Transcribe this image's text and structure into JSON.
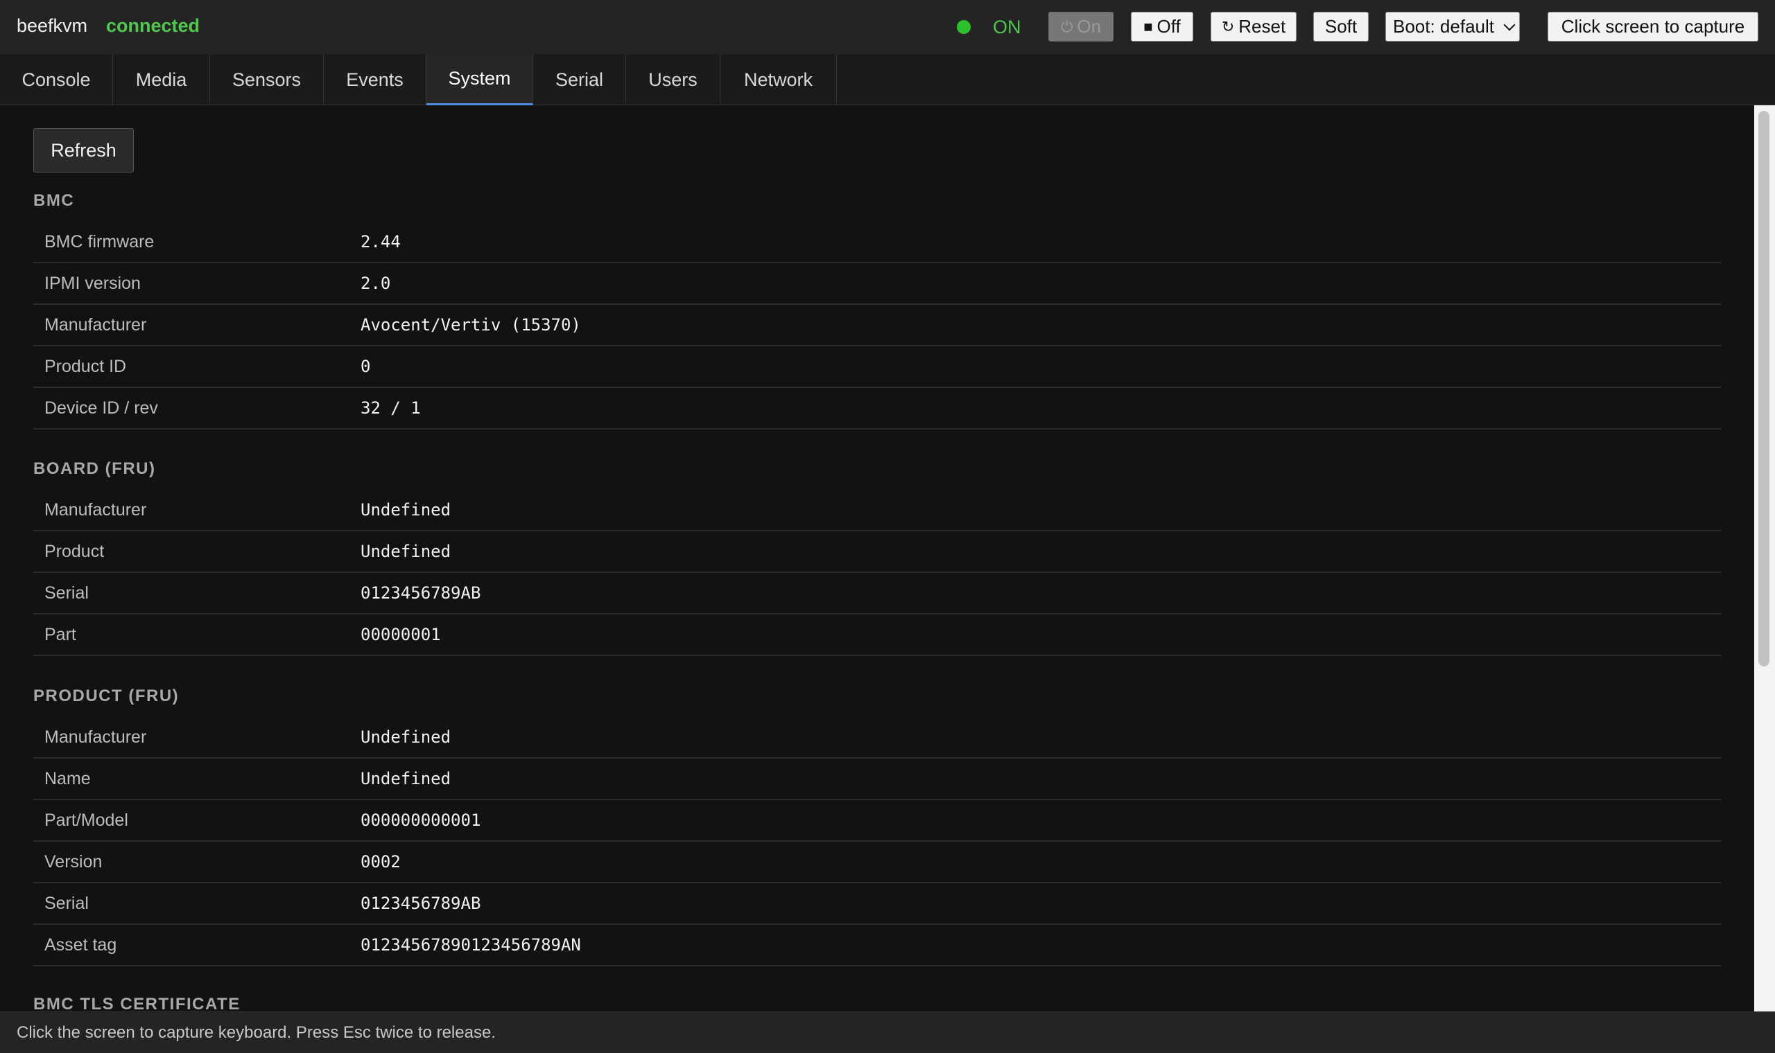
{
  "header": {
    "hostname": "beefkvm",
    "connection_status": "connected",
    "power_state": "ON",
    "buttons": {
      "on": "On",
      "off": "Off",
      "reset": "Reset",
      "soft": "Soft",
      "boot": "Boot: default",
      "capture": "Click screen to capture"
    },
    "icons": {
      "on": "power-icon",
      "off": "stop-square-icon",
      "reset": "reload-icon"
    },
    "colors": {
      "connected": "#4ec94e",
      "power_dot": "#2bc12b",
      "tab_active_accent": "#4a90e2"
    }
  },
  "tabs": [
    "Console",
    "Media",
    "Sensors",
    "Events",
    "System",
    "Serial",
    "Users",
    "Network"
  ],
  "active_tab": "System",
  "refresh_label": "Refresh",
  "sections": {
    "bmc": {
      "title": "BMC",
      "rows": [
        {
          "k": "BMC firmware",
          "v": "2.44"
        },
        {
          "k": "IPMI version",
          "v": "2.0"
        },
        {
          "k": "Manufacturer",
          "v": "Avocent/Vertiv (15370)"
        },
        {
          "k": "Product ID",
          "v": "0"
        },
        {
          "k": "Device ID / rev",
          "v": "32 / 1"
        }
      ]
    },
    "board": {
      "title": "BOARD (FRU)",
      "rows": [
        {
          "k": "Manufacturer",
          "v": "Undefined"
        },
        {
          "k": "Product",
          "v": "Undefined"
        },
        {
          "k": "Serial",
          "v": "0123456789AB"
        },
        {
          "k": "Part",
          "v": "00000001"
        }
      ]
    },
    "product": {
      "title": "PRODUCT (FRU)",
      "rows": [
        {
          "k": "Manufacturer",
          "v": "Undefined"
        },
        {
          "k": "Name",
          "v": "Undefined"
        },
        {
          "k": "Part/Model",
          "v": "000000000001"
        },
        {
          "k": "Version",
          "v": "0002"
        },
        {
          "k": "Serial",
          "v": "0123456789AB"
        },
        {
          "k": "Asset tag",
          "v": "01234567890123456789AN"
        }
      ]
    },
    "tls": {
      "title": "BMC TLS CERTIFICATE"
    }
  },
  "status_message": "Click the screen to capture keyboard. Press Esc twice to release."
}
